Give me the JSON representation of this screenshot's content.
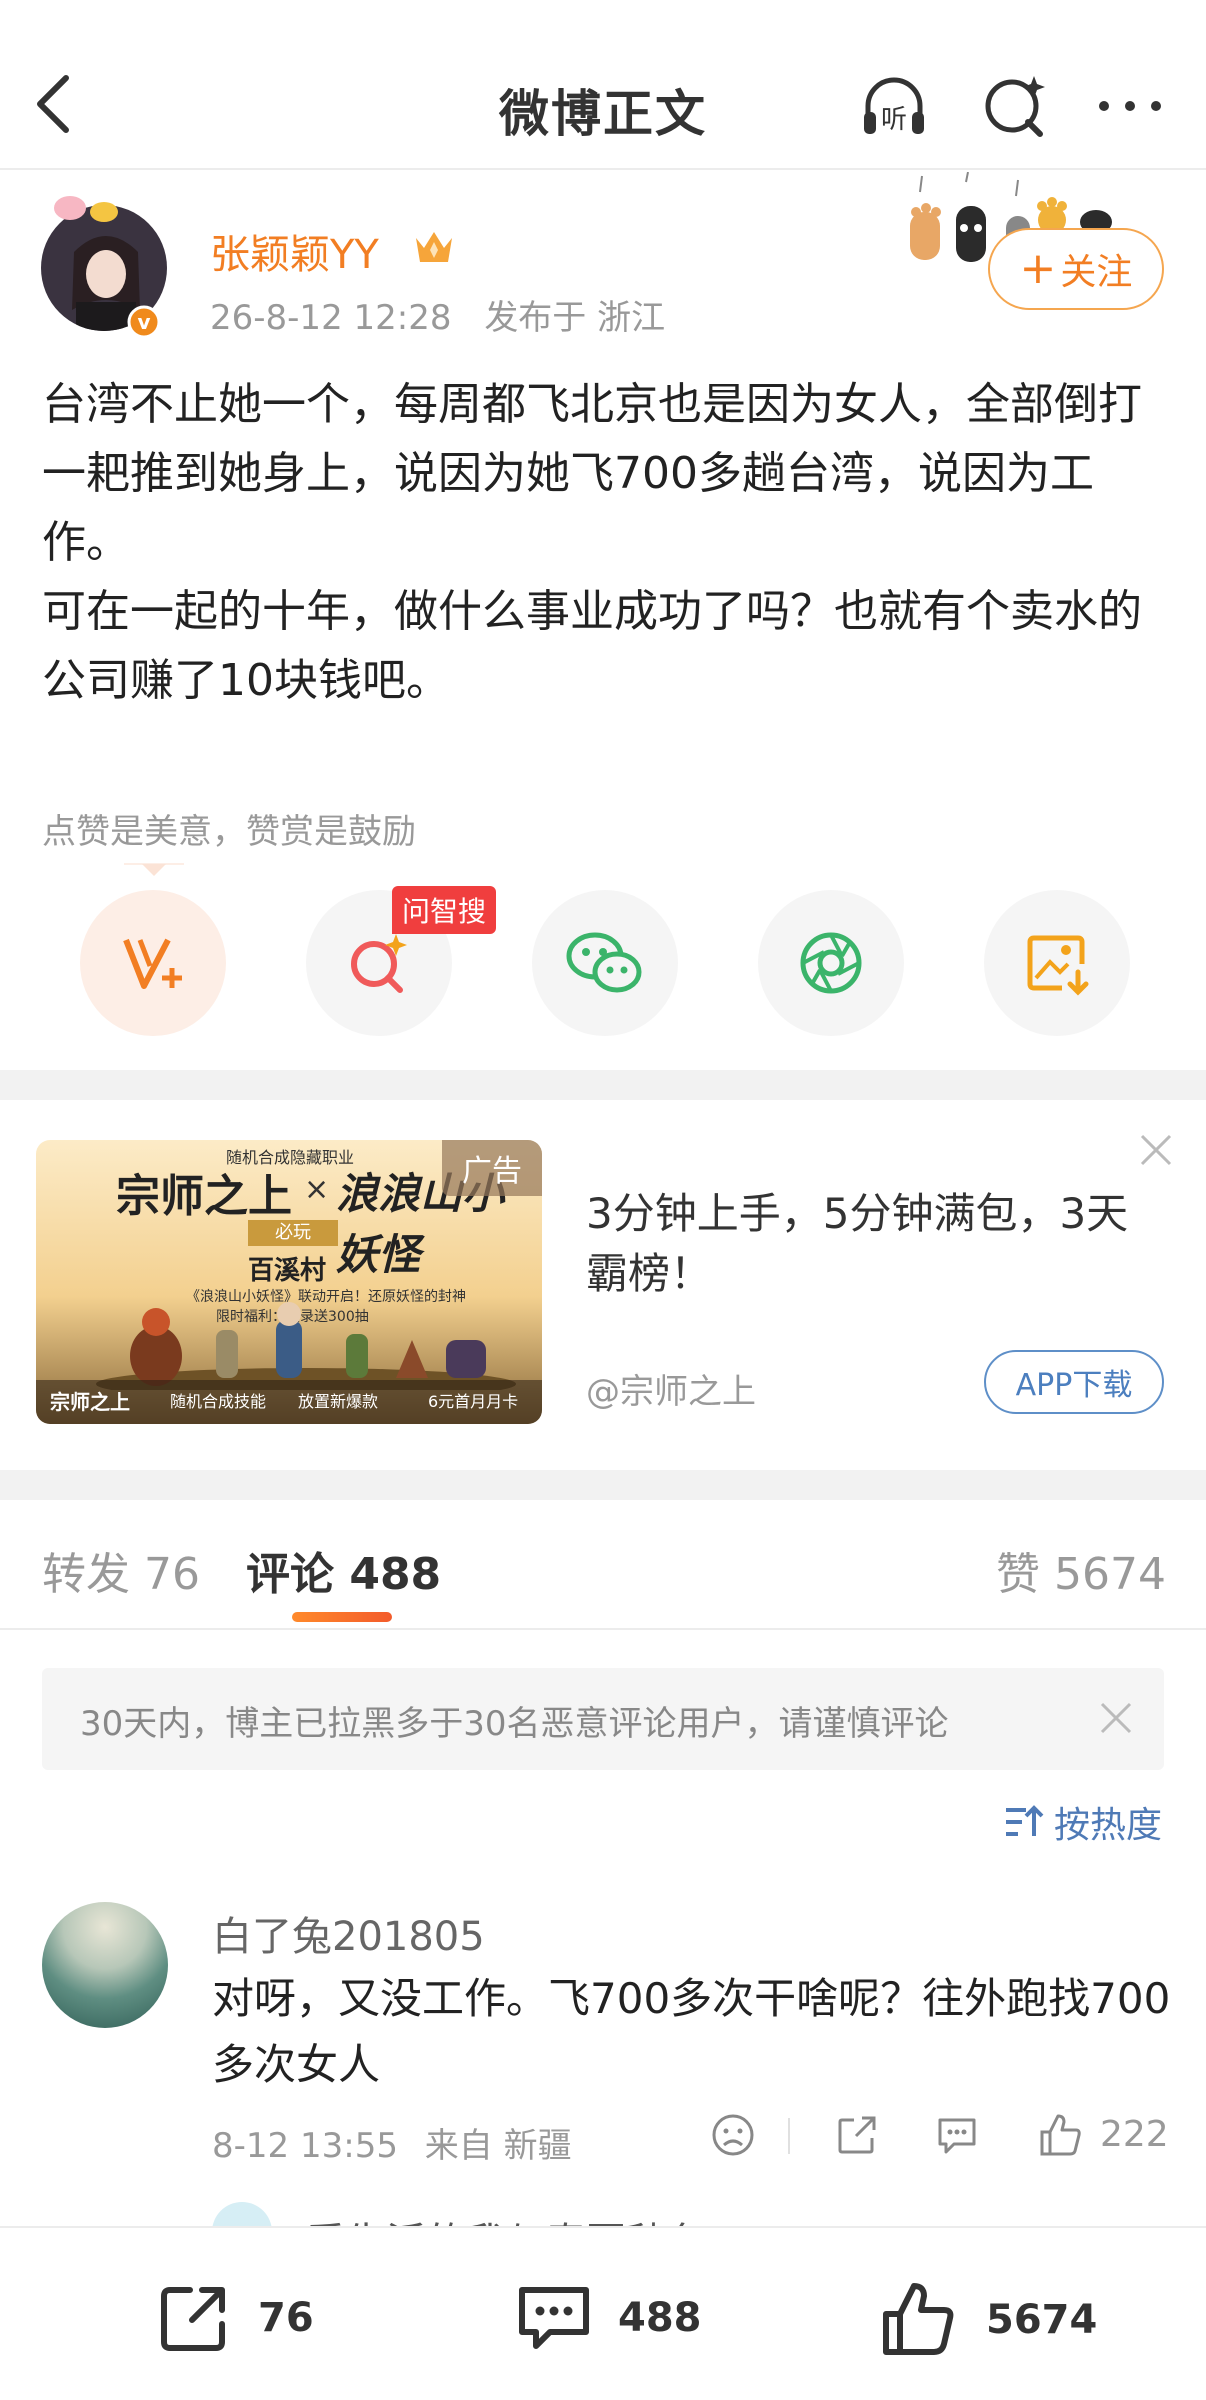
{
  "header": {
    "title": "微博正文",
    "listen_label": "听"
  },
  "author": {
    "name": "张颖颖YY",
    "time": "26-8-12 12:28",
    "location": "发布于 浙江",
    "verified_mark": "v",
    "follow_label": "关注",
    "follow_plus": "+"
  },
  "post": {
    "paragraphs": [
      "台湾不止她一个，每周都飞北京也是因为女人，全部倒打一耙推到她身上，说因为她飞700多趟台湾，说因为工作。",
      "可在一起的十年，做什么事业成功了吗？也就有个卖水的公司赚了10块钱吧。"
    ]
  },
  "reward": {
    "hint": "点赞是美意，赞赏是鼓励",
    "ai_badge": "问智搜"
  },
  "ad": {
    "tag": "广告",
    "top_line": "随机合成隐藏职业",
    "game_title": "宗师之上",
    "x_mark": "×",
    "collab": "浪浪山小妖怪",
    "must_play": "必玩",
    "village": "百溪村",
    "small_line_1": "《浪浪山小妖怪》联动开启！还原妖怪的封神",
    "small_line_2": "限时福利：登录送300抽",
    "bottom_labels": [
      "宗师之上",
      "随机合成技能",
      "放置新爆款",
      "6元首月月卡"
    ],
    "text": "3分钟上手，5分钟满包，3天霸榜！",
    "source": "@宗师之上",
    "button": "APP下载"
  },
  "tabs": [
    {
      "label": "转发",
      "count": "76"
    },
    {
      "label": "评论",
      "count": "488"
    },
    {
      "label": "赞",
      "count": "5674"
    }
  ],
  "notice": "30天内，博主已拉黑多于30名恶意评论用户，请谨慎评论",
  "sort_label": "按热度",
  "comment": {
    "name": "白了兔201805",
    "text": "对呀，又没工作。飞700多次干啥呢？往外跑找700多次女人",
    "time": "8-12 13:55",
    "source": "来自 新疆",
    "likes": "222"
  },
  "next_comment_peek": "爱生活的我与春夏秋冬",
  "bottom": {
    "repost": "76",
    "comments": "488",
    "likes": "5674"
  },
  "colors": {
    "accent_orange": "#f27e23",
    "link_blue": "#4f7ab6",
    "badge_red": "#f03e3e"
  }
}
